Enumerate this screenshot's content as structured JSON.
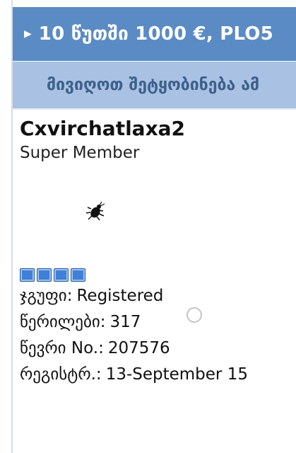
{
  "header": {
    "thread_title": "10 წუთში 1000 €, PLO5"
  },
  "notification": {
    "text": "მივიღოთ შეტყობინება ამ"
  },
  "post": {
    "username": "Cxvirchatlaxa2",
    "rank": "Super Member",
    "rank_pips": 4,
    "group_label": "ჯგუფი:",
    "group_value": "Registered",
    "posts_label": "წერილები:",
    "posts_value": "317",
    "member_no_label": "წევრი No.:",
    "member_no_value": "207576",
    "registered_label": "რეგისტრ.:",
    "registered_value": "13-September 15"
  },
  "icons": {
    "title_arrow": "triangle-right-icon",
    "avatar": "bug-icon",
    "indicator": "circle-indicator-icon"
  },
  "colors": {
    "title_bar": "#5a8bc4",
    "notify_bar": "#a9c2e3",
    "notify_text": "#3d5f8a",
    "pip": "#3f7fd6"
  }
}
